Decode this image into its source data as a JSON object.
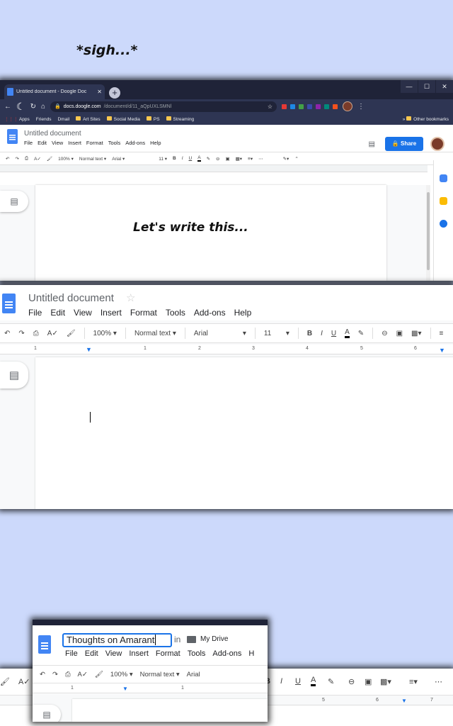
{
  "caption_top": "*sigh...*",
  "chrome": {
    "tab_title": "Untitled document - Doogle Doc",
    "url_domain": "docs.doogle.com",
    "url_path": "/document/d/11_aQpUXLSMNl",
    "bookmarks": [
      "Apps",
      "Friends",
      "Dmail",
      "Art Sites",
      "Social Media",
      "PS",
      "Streaming"
    ],
    "other_bookmarks": "Other bookmarks"
  },
  "doc_small": {
    "title": "Untitled document",
    "menu": [
      "File",
      "Edit",
      "View",
      "Insert",
      "Format",
      "Tools",
      "Add-ons",
      "Help"
    ],
    "share": "Share",
    "zoom": "100%",
    "style": "Normal text",
    "font": "Arial",
    "size": "11",
    "caption": "Let's write this..."
  },
  "doc_large": {
    "title": "Untitled document",
    "menu": [
      "File",
      "Edit",
      "View",
      "Insert",
      "Format",
      "Tools",
      "Add-ons",
      "Help"
    ],
    "zoom": "100%",
    "style": "Normal text",
    "font": "Arial",
    "size": "11",
    "ruler_numbers": [
      "1",
      "1",
      "2",
      "3",
      "4",
      "5",
      "6"
    ]
  },
  "doc_rename": {
    "title_input": "Thoughts on Amarant",
    "in_label": "in",
    "location": "My Drive",
    "menu": [
      "File",
      "Edit",
      "View",
      "Insert",
      "Format",
      "Tools",
      "Add-ons",
      "H"
    ],
    "zoom": "100%",
    "style": "Normal text",
    "font": "Arial",
    "ruler_numbers": [
      "1",
      "1"
    ]
  },
  "strip_bottom": {
    "ruler_numbers": [
      "5",
      "6",
      "7"
    ]
  },
  "colors": {
    "background": "#ccd9fb",
    "docs_blue": "#4285f4",
    "share_blue": "#1a73e8",
    "chrome_dark": "#1f2338"
  }
}
